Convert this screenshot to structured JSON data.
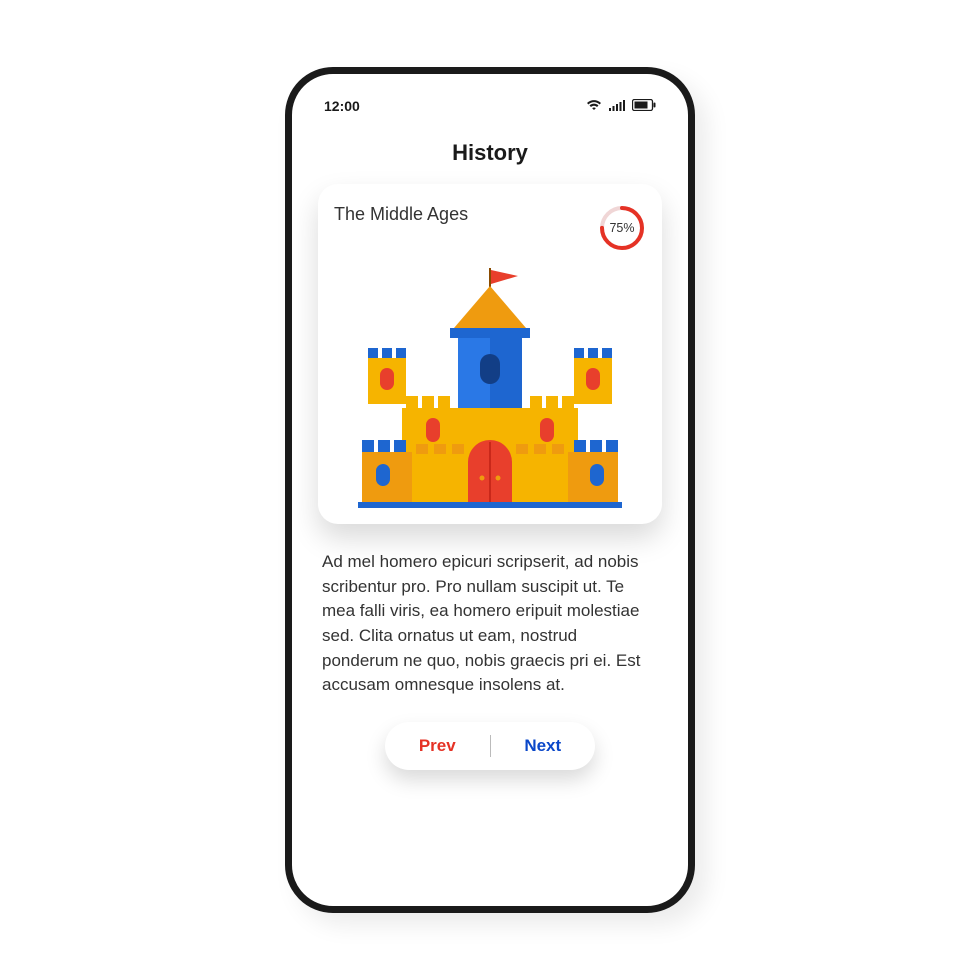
{
  "status": {
    "time": "12:00"
  },
  "page": {
    "title": "History"
  },
  "card": {
    "title": "The Middle Ages",
    "progress_label": "75%",
    "progress_value": 75
  },
  "body": {
    "text": "Ad mel homero epicuri scripserit, ad nobis scribentur pro. Pro nullam suscipit ut. Te mea falli viris, ea homero eripuit molestiae sed. Clita ornatus ut eam, nostrud ponderum ne quo, nobis graecis pri ei. Est accusam omnesque insolens at."
  },
  "nav": {
    "prev_label": "Prev",
    "next_label": "Next"
  },
  "colors": {
    "accent_red": "#e53225",
    "accent_blue": "#0a47c9",
    "castle_yellow": "#f6b400",
    "castle_orange": "#ef9b0f",
    "castle_blue": "#1e66d0",
    "castle_red": "#e83f2c"
  }
}
